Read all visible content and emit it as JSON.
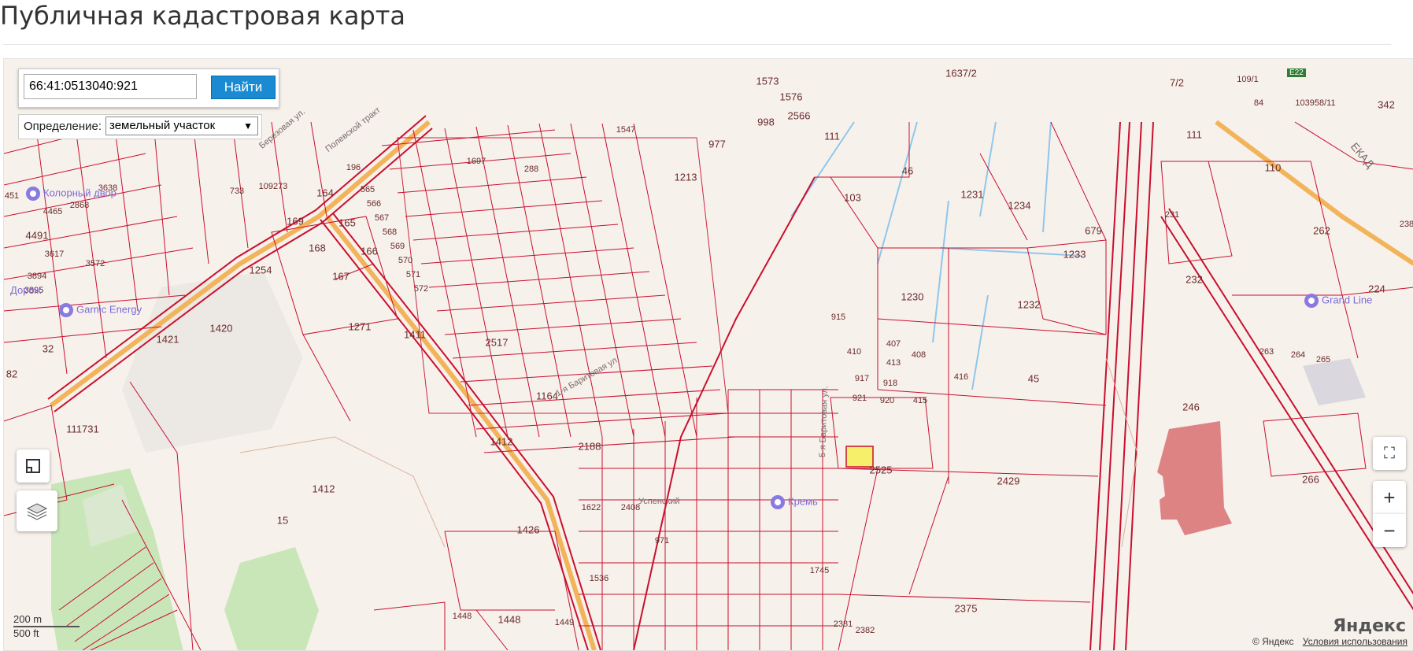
{
  "page": {
    "title": "Публичная кадастровая карта"
  },
  "search": {
    "value": "66:41:0513040:921",
    "button_label": "Найти"
  },
  "definition": {
    "label": "Определение:",
    "selected": "земельный участок"
  },
  "controls": {
    "zoom_in": "+",
    "zoom_out": "−",
    "fullscreen_icon": "fullscreen-icon",
    "ruler_icon": "ruler-icon",
    "layers_icon": "layers-icon"
  },
  "scale": {
    "metric": "200 m",
    "imperial": "500 ft"
  },
  "footer": {
    "copyright": "© Яндекс",
    "terms": "Условия использования",
    "logo": "Яндекс"
  },
  "highlight": {
    "parcel": "921",
    "color": "#f5ef6a"
  },
  "colors": {
    "boundary": "#c8102e",
    "road": "#f2b45a",
    "poi": "#7b6bd6"
  },
  "parcels": [
    "1637/2",
    "1573",
    "1576",
    "2566",
    "998",
    "977",
    "111",
    "1213",
    "1547",
    "1697",
    "288",
    "196",
    "565",
    "566",
    "567",
    "568",
    "569",
    "570",
    "571",
    "572",
    "733",
    "3638",
    "2868",
    "4465",
    "109273",
    "164",
    "169",
    "165",
    "168",
    "167",
    "166",
    "1254",
    "1420",
    "1271",
    "1411",
    "2517",
    "1164",
    "1412",
    "1412",
    "2188",
    "1426",
    "1622",
    "2408",
    "1536",
    "971",
    "1745",
    "1448",
    "1448",
    "1449",
    "2381",
    "2382",
    "2375",
    "103",
    "46",
    "1231",
    "1234",
    "679",
    "1233",
    "1230",
    "1232",
    "915",
    "410",
    "407",
    "413",
    "408",
    "416",
    "917",
    "918",
    "921",
    "920",
    "415",
    "45",
    "2525",
    "2429",
    "7/2",
    "109/1",
    "84",
    "103958/11",
    "342",
    "111",
    "110",
    "231",
    "262",
    "238",
    "232",
    "224",
    "263",
    "264",
    "265",
    "246",
    "266",
    "111731",
    "32",
    "82",
    "4491",
    "3617",
    "3572",
    "3894",
    "3895",
    "15",
    "1421",
    "451"
  ],
  "pois": [
    "Колорный двор",
    "Garnic Energy",
    "Grand Line",
    "Кремь",
    "Дорож"
  ],
  "streets": [
    "Полевской тракт",
    "Березовая ул.",
    "1-я Баритовая ул.",
    "Успенский",
    "5-я Баритовая ул.",
    "ЕКАД",
    "Е22"
  ]
}
